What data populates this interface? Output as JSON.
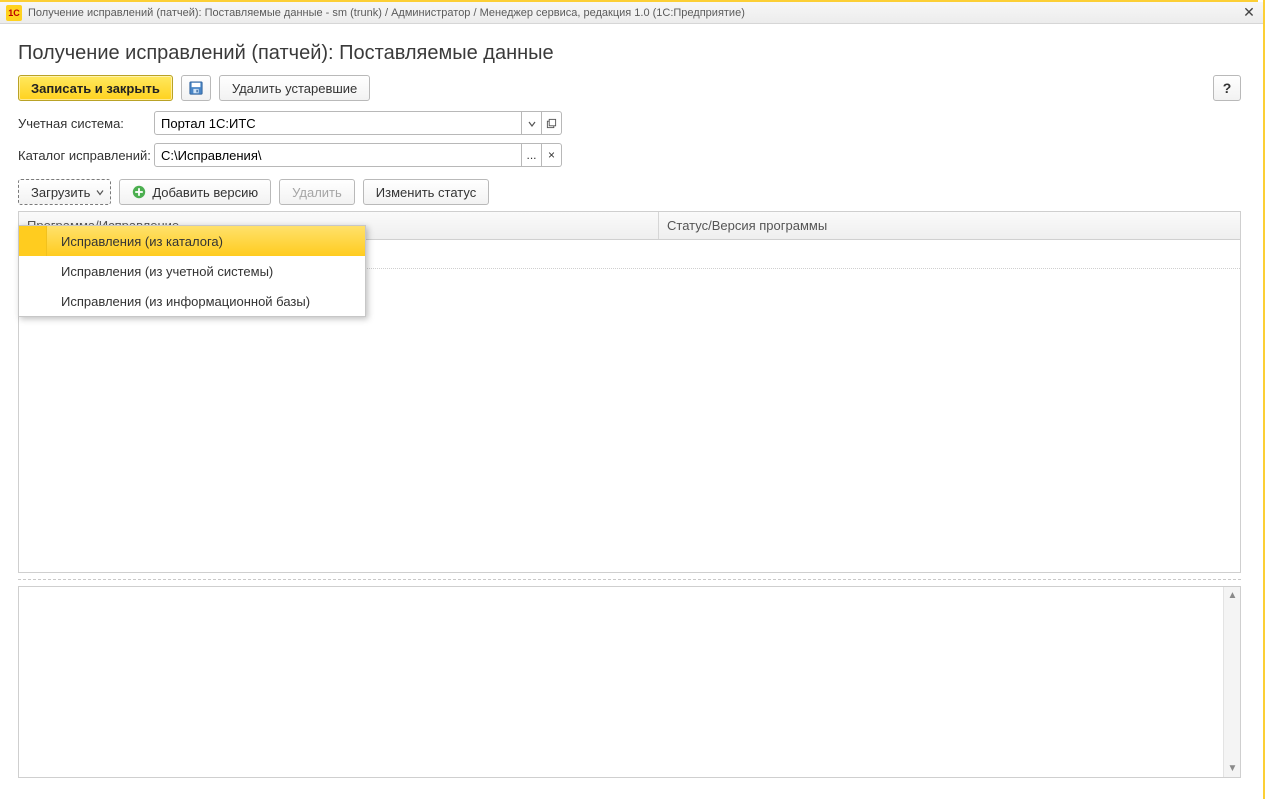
{
  "window": {
    "title": "Получение исправлений (патчей): Поставляемые данные - sm (trunk) / Администратор / Менеджер сервиса, редакция 1.0  (1С:Предприятие)"
  },
  "page": {
    "title": "Получение исправлений (патчей): Поставляемые данные"
  },
  "toolbar": {
    "save_close": "Записать и закрыть",
    "delete_old": "Удалить устаревшие",
    "help": "?"
  },
  "form": {
    "acct_label": "Учетная система:",
    "acct_value": "Портал 1С:ИТС",
    "path_label": "Каталог исправлений:",
    "path_value": "C:\\Исправления\\"
  },
  "sec_toolbar": {
    "load": "Загрузить",
    "add_version": "Добавить версию",
    "delete": "Удалить",
    "change_status": "Изменить статус"
  },
  "grid": {
    "col1": "Программа/Исправление",
    "col2": "Статус/Версия программы"
  },
  "menu": {
    "items": [
      "Исправления (из каталога)",
      "Исправления (из учетной системы)",
      "Исправления (из информационной базы)"
    ]
  },
  "bottom": {
    "dots": "...",
    "clear": "×"
  }
}
